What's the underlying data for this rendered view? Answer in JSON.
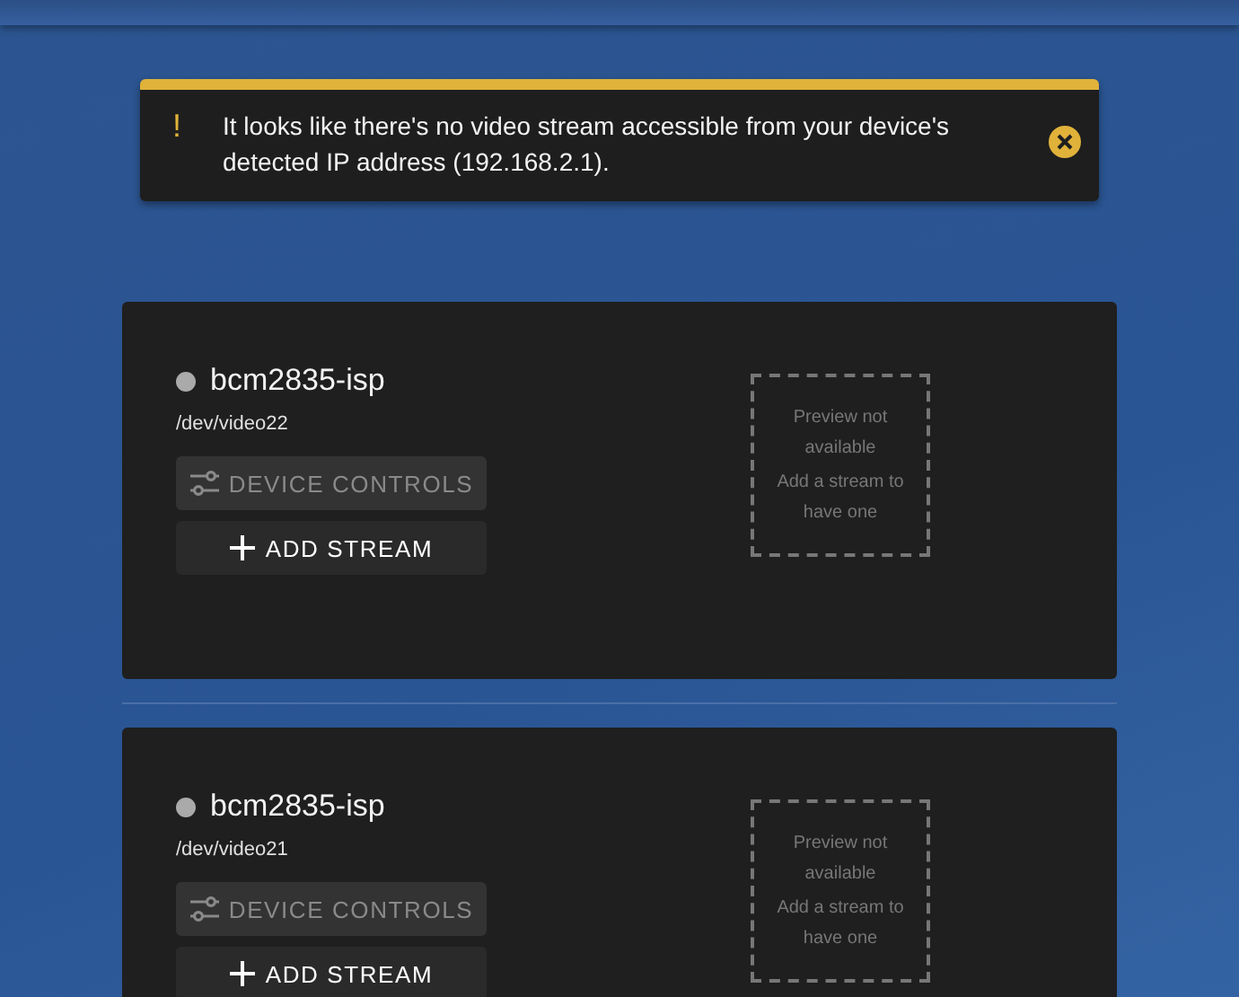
{
  "alert": {
    "icon": "!",
    "message": "It looks like there's no video stream accessible from your device's detected IP address (192.168.2.1)."
  },
  "devices": [
    {
      "name": "bcm2835-isp",
      "path": "/dev/video22",
      "active": false,
      "controls": {
        "label": "DEVICE CONTROLS",
        "disabled": true
      },
      "add_stream": {
        "label": "ADD STREAM"
      },
      "preview": [
        "Preview not available",
        "Add a stream to have one"
      ]
    },
    {
      "name": "bcm2835-isp",
      "path": "/dev/video21",
      "active": false,
      "controls": {
        "label": "DEVICE CONTROLS",
        "disabled": true
      },
      "add_stream": {
        "label": "ADD STREAM"
      },
      "preview": [
        "Preview not available",
        "Add a stream to have one"
      ]
    }
  ]
}
